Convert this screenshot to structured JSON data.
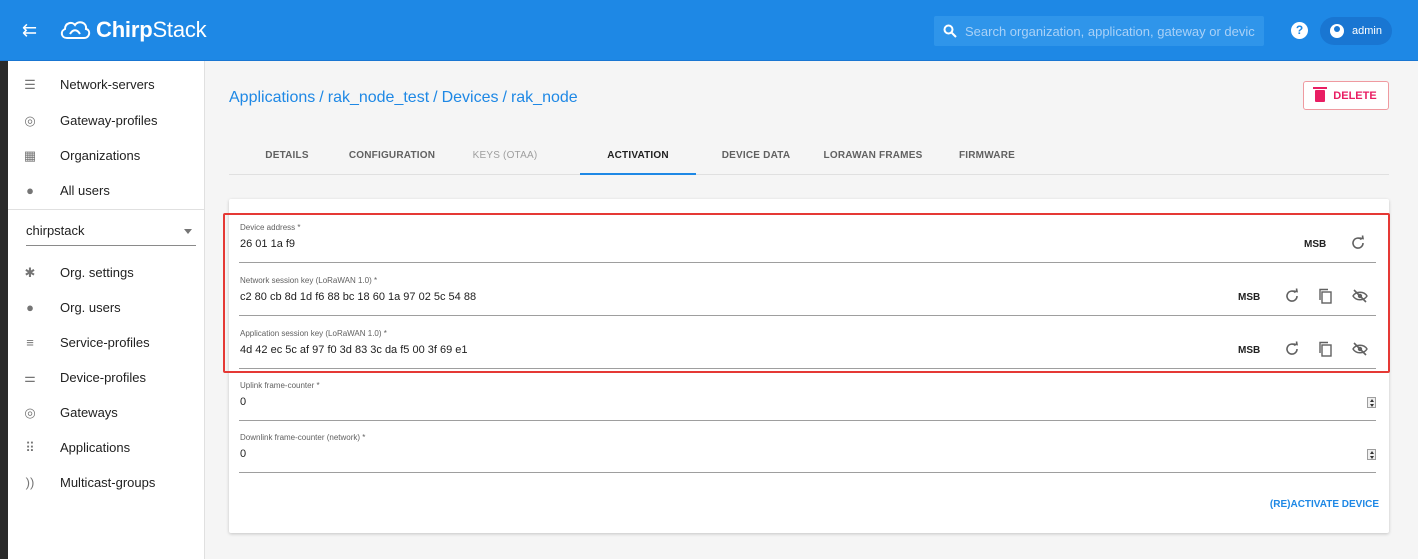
{
  "app": {
    "brand_prefix": "Chirp",
    "brand_suffix": "Stack",
    "search_placeholder": "Search organization, application, gateway or device",
    "help_label": "?",
    "user_label": "admin"
  },
  "sidebar": {
    "global_items": [
      {
        "label": "Network-servers",
        "icon": "server-icon"
      },
      {
        "label": "Gateway-profiles",
        "icon": "radio-tower-icon"
      },
      {
        "label": "Organizations",
        "icon": "domain-icon"
      },
      {
        "label": "All users",
        "icon": "user-icon"
      }
    ],
    "org_selected": "chirpstack",
    "org_items": [
      {
        "label": "Org. settings",
        "icon": "gear-icon"
      },
      {
        "label": "Org. users",
        "icon": "user-icon"
      },
      {
        "label": "Service-profiles",
        "icon": "user-list-icon"
      },
      {
        "label": "Device-profiles",
        "icon": "sliders-icon"
      },
      {
        "label": "Gateways",
        "icon": "radio-tower-icon"
      },
      {
        "label": "Applications",
        "icon": "apps-grid-icon"
      },
      {
        "label": "Multicast-groups",
        "icon": "rss-icon"
      }
    ]
  },
  "breadcrumb": {
    "items": [
      "Applications",
      "rak_node_test",
      "Devices",
      "rak_node"
    ],
    "separator": "/"
  },
  "actions": {
    "delete_label": "DELETE"
  },
  "tabs": [
    {
      "label": "DETAILS",
      "state": "normal"
    },
    {
      "label": "CONFIGURATION",
      "state": "normal"
    },
    {
      "label": "KEYS (OTAA)",
      "state": "disabled"
    },
    {
      "label": "ACTIVATION",
      "state": "active"
    },
    {
      "label": "DEVICE DATA",
      "state": "normal"
    },
    {
      "label": "LORAWAN FRAMES",
      "state": "normal"
    },
    {
      "label": "FIRMWARE",
      "state": "normal"
    }
  ],
  "form": {
    "device_address": {
      "label": "Device address *",
      "value": "26 01 1a f9",
      "byte_order": "MSB"
    },
    "nwk_s_key": {
      "label": "Network session key (LoRaWAN 1.0) *",
      "value": "c2 80 cb 8d 1d f6 88 bc 18 60 1a 97 02 5c 54 88",
      "byte_order": "MSB"
    },
    "app_s_key": {
      "label": "Application session key (LoRaWAN 1.0) *",
      "value": "4d 42 ec 5c af 97 f0 3d 83 3c da f5 00 3f 69 e1",
      "byte_order": "MSB"
    },
    "uplink_fcnt": {
      "label": "Uplink frame-counter *",
      "value": "0"
    },
    "downlink_fcnt": {
      "label": "Downlink frame-counter (network) *",
      "value": "0"
    },
    "submit_label": "(RE)ACTIVATE DEVICE"
  },
  "colors": {
    "appbar": "#1e88e5",
    "accent": "#1e88e5",
    "delete": "#e91e63",
    "highlight_box": "#e53935"
  }
}
